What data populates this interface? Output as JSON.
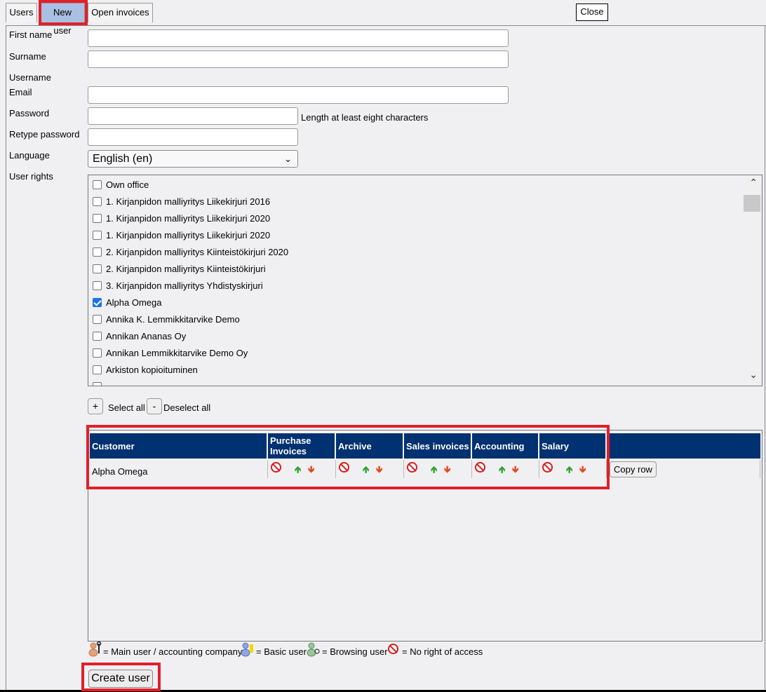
{
  "tabs": [
    {
      "label": "Users"
    },
    {
      "label": "New user"
    },
    {
      "label": "Open invoices"
    }
  ],
  "close_label": "Close",
  "form": {
    "first_name_label": "First name",
    "first_name_value": "",
    "surname_label": "Surname",
    "surname_value": "",
    "username_label": "Username",
    "email_label": "Email",
    "email_value": "",
    "password_label": "Password",
    "password_hint": "Length at least eight characters",
    "retype_password_label": "Retype password",
    "language_label": "Language",
    "language_value": "English (en)",
    "user_rights_label": "User rights"
  },
  "user_rights": [
    {
      "label": "Own office",
      "checked": false
    },
    {
      "label": "1. Kirjanpidon malliyritys Liikekirjuri 2016",
      "checked": false
    },
    {
      "label": "1. Kirjanpidon malliyritys Liikekirjuri 2020",
      "checked": false
    },
    {
      "label": "1. Kirjanpidon malliyritys Liikekirjuri 2020",
      "checked": false
    },
    {
      "label": "2. Kirjanpidon malliyritys Kiinteistökirjuri 2020",
      "checked": false
    },
    {
      "label": "2. Kirjanpidon malliyritys Kiinteistökirjuri",
      "checked": false
    },
    {
      "label": "3. Kirjanpidon malliyritys Yhdistyskirjuri",
      "checked": false
    },
    {
      "label": "Alpha Omega",
      "checked": true
    },
    {
      "label": "Annika K. Lemmikkitarvike Demo",
      "checked": false
    },
    {
      "label": "Annikan Ananas Oy",
      "checked": false
    },
    {
      "label": "Annikan Lemmikkitarvike Demo Oy",
      "checked": false
    },
    {
      "label": "Arkiston kopioituminen",
      "checked": false
    }
  ],
  "select_all_label": "Select all",
  "deselect_all_label": "Deselect all",
  "plus_symbol": "+",
  "minus_symbol": "-",
  "rights_table": {
    "headers": [
      "Customer",
      "Purchase Invoices",
      "Archive",
      "Sales invoices",
      "Accounting",
      "Salary"
    ],
    "rows": [
      {
        "customer": "Alpha Omega",
        "copy_label": "Copy row"
      }
    ]
  },
  "legend": {
    "main_user": "= Main user / accounting company",
    "basic_user": "= Basic user",
    "browsing_user": "= Browsing user",
    "no_access": "= No right of access"
  },
  "create_label": "Create user",
  "colors": {
    "header_blue": "#003171",
    "active_tab": "#a9c0e2",
    "highlight_red": "#e0202a",
    "checkbox_blue": "#1a73e8"
  }
}
